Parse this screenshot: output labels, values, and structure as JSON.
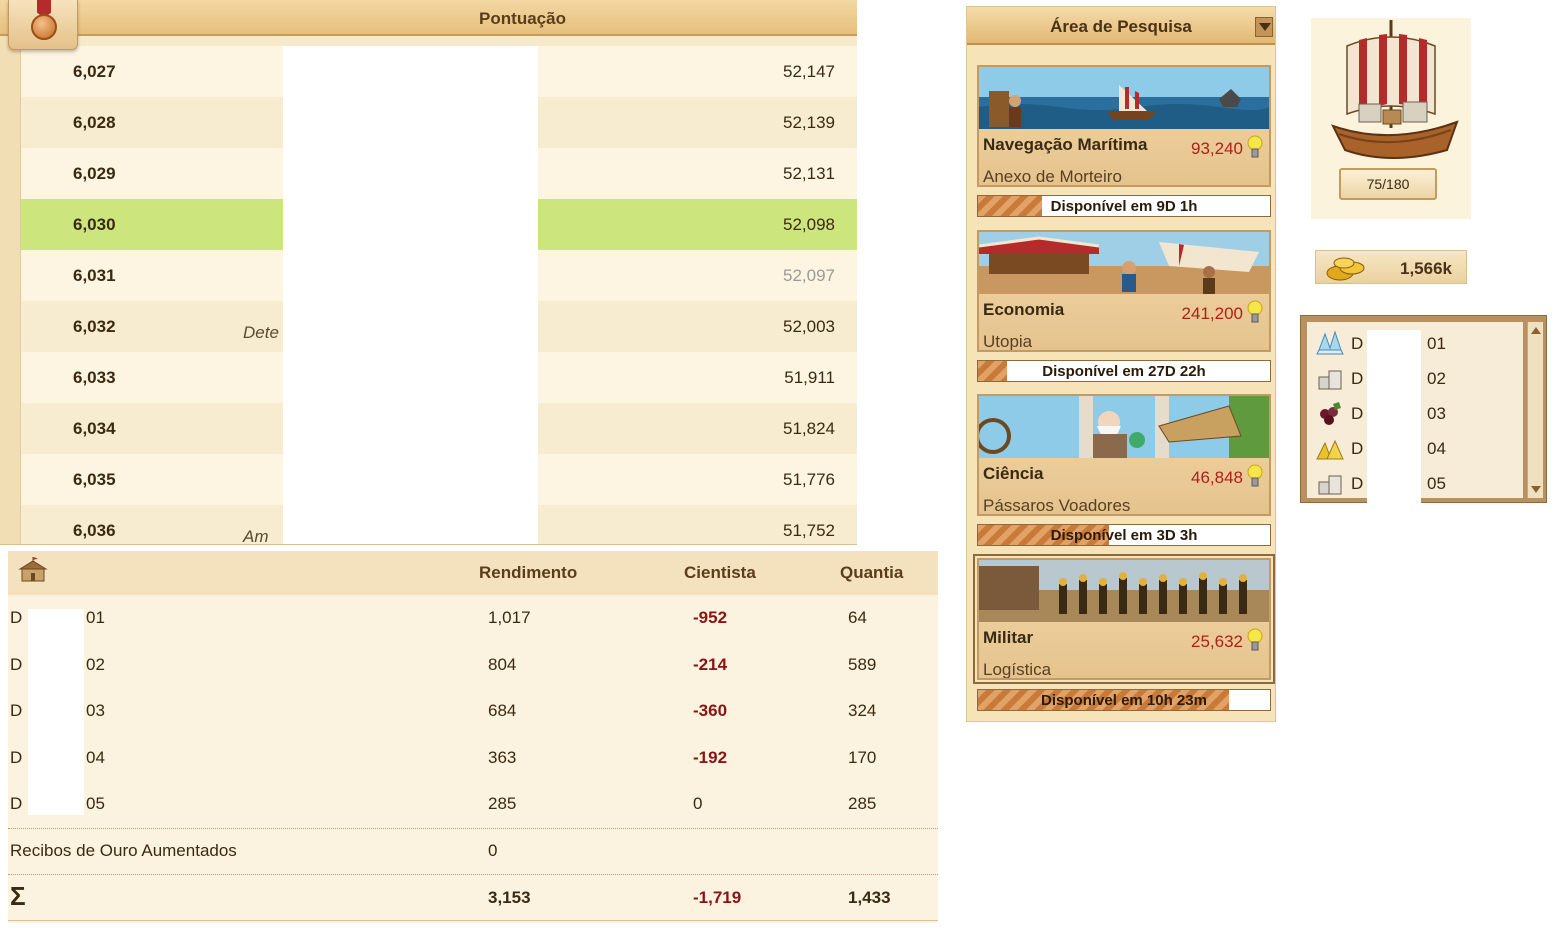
{
  "ranking": {
    "header": "Pontuação",
    "rows": [
      {
        "rank": "6,027",
        "partial_name": "",
        "score": "52,147"
      },
      {
        "rank": "6,028",
        "partial_name": "",
        "score": "52,139"
      },
      {
        "rank": "6,029",
        "partial_name": "",
        "score": "52,131"
      },
      {
        "rank": "6,030",
        "partial_name": "",
        "score": "52,098"
      },
      {
        "rank": "6,031",
        "partial_name": "",
        "score": "52,097"
      },
      {
        "rank": "6,032",
        "partial_name": "Dete",
        "score": "52,003"
      },
      {
        "rank": "6,033",
        "partial_name": "",
        "score": "51,911"
      },
      {
        "rank": "6,034",
        "partial_name": "",
        "score": "51,824"
      },
      {
        "rank": "6,035",
        "partial_name": "",
        "score": "51,776"
      },
      {
        "rank": "6,036",
        "partial_name": "Am",
        "score": "51,752"
      }
    ],
    "highlight_color": "#cde57d"
  },
  "production": {
    "headers": {
      "yield": "Rendimento",
      "scientist": "Cientista",
      "quantity": "Quantia"
    },
    "rows": [
      {
        "name": "D",
        "id": "01",
        "yield": "1,017",
        "scientist": "-952",
        "quantity": "64"
      },
      {
        "name": "D",
        "id": "02",
        "yield": "804",
        "scientist": "-214",
        "quantity": "589"
      },
      {
        "name": "D",
        "id": "03",
        "yield": "684",
        "scientist": "-360",
        "quantity": "324"
      },
      {
        "name": "D",
        "id": "04",
        "yield": "363",
        "scientist": "-192",
        "quantity": "170"
      },
      {
        "name": "D",
        "id": "05",
        "yield": "285",
        "scientist": "0",
        "quantity": "285"
      }
    ],
    "bonus": {
      "label": "Recibos de Ouro Aumentados",
      "value": "0"
    },
    "totals": {
      "symbol": "Σ",
      "yield": "3,153",
      "scientist": "-1,719",
      "quantity": "1,433"
    }
  },
  "research": {
    "title": "Área de Pesquisa",
    "cards": [
      {
        "name": "Navegação Marítima",
        "cost": "93,240",
        "target": "Anexo de Morteiro",
        "available": "Disponível em 9D 1h",
        "progress": 0.22,
        "scene": "sea"
      },
      {
        "name": "Economia",
        "cost": "241,200",
        "target": "Utopia",
        "available": "Disponível em 27D 22h",
        "progress": 0.1,
        "scene": "market"
      },
      {
        "name": "Ciência",
        "cost": "46,848",
        "target": "Pássaros Voadores",
        "available": "Disponível em 3D 3h",
        "progress": 0.45,
        "scene": "science"
      },
      {
        "name": "Militar",
        "cost": "25,632",
        "target": "Logística",
        "available": "Disponível em 10h 23m",
        "progress": 0.86,
        "scene": "army"
      }
    ],
    "accent": "#b0201b"
  },
  "ship": {
    "capacity": "75/180"
  },
  "gold": {
    "value": "1,566k"
  },
  "resources": [
    {
      "icon": "crystal-icon",
      "name": "D",
      "id": "01"
    },
    {
      "icon": "marble-icon",
      "name": "D",
      "id": "02"
    },
    {
      "icon": "wine-icon",
      "name": "D",
      "id": "03"
    },
    {
      "icon": "sulfur-icon",
      "name": "D",
      "id": "04"
    },
    {
      "icon": "stone-icon",
      "name": "D",
      "id": "05"
    }
  ]
}
